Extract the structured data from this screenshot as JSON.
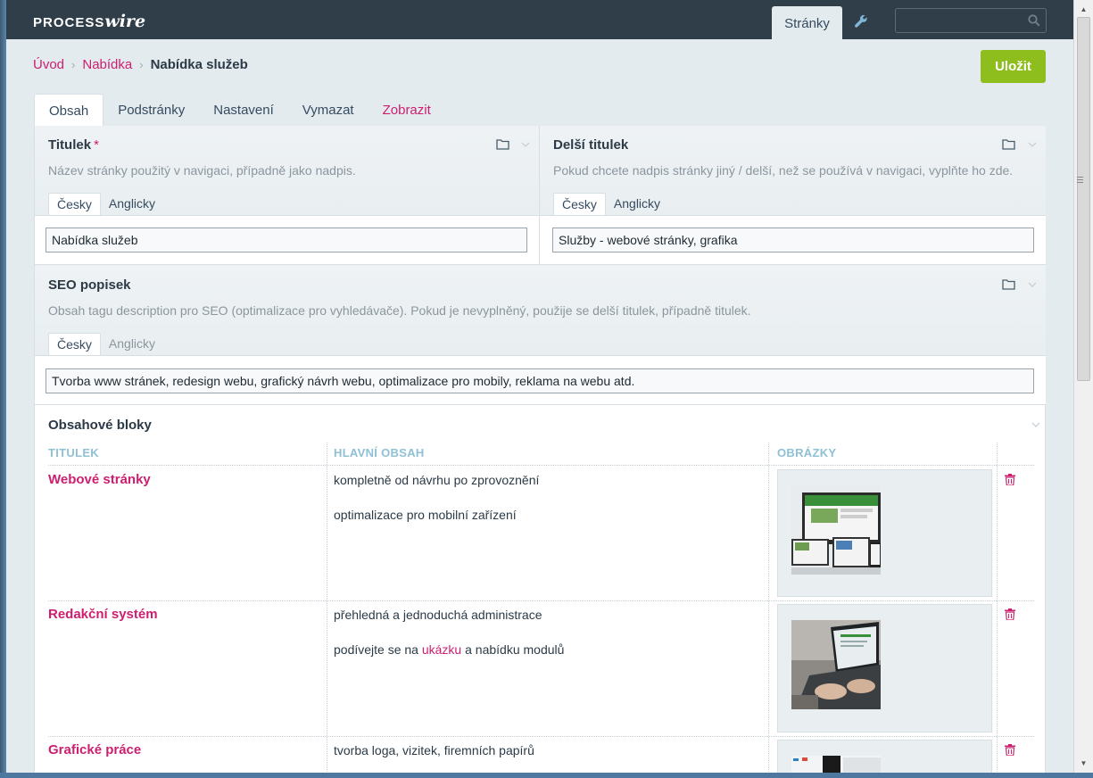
{
  "masthead": {
    "logo_main": "PROCESS",
    "logo_accent": "wire",
    "nav_pages": "Stránky",
    "search_placeholder": ""
  },
  "breadcrumb": {
    "items": [
      "Úvod",
      "Nabídka"
    ],
    "current": "Nabídka služeb"
  },
  "save_label": "Uložit",
  "tabs": [
    "Obsah",
    "Podstránky",
    "Nastavení",
    "Vymazat",
    "Zobrazit"
  ],
  "fields": {
    "title": {
      "label": "Titulek",
      "required_mark": "*",
      "description": "Název stránky použitý v navigaci, případně jako nadpis.",
      "lang_tabs": [
        "Česky",
        "Anglicky"
      ],
      "value": "Nabídka služeb"
    },
    "long_title": {
      "label": "Delší titulek",
      "description": "Pokud chcete nadpis stránky jiný / delší, než se používá v navigaci, vyplňte ho zde.",
      "lang_tabs": [
        "Česky",
        "Anglicky"
      ],
      "value": "Služby - webové stránky, grafika"
    },
    "seo": {
      "label": "SEO popisek",
      "description": "Obsah tagu description pro SEO (optimalizace pro vyhledávače). Pokud je nevyplněný, použije se delší titulek, případně titulek.",
      "lang_tabs": [
        "Česky",
        "Anglicky"
      ],
      "value": "Tvorba www stránek, redesign webu, grafický návrh webu, optimalizace pro mobily, reklama na webu atd."
    }
  },
  "blocks": {
    "title": "Obsahové bloky",
    "columns": [
      "TITULEK",
      "HLAVNÍ OBSAH",
      "OBRÁZKY"
    ],
    "rows": [
      {
        "title": "Webové stránky",
        "line1": "kompletně od návrhu po zprovoznění",
        "line2": "optimalizace pro mobilní zařízení"
      },
      {
        "title": "Redakční systém",
        "line1": "přehledná a jednoduchá administrace",
        "line2_pre": "podívejte se na",
        "line2_link": "ukázku",
        "line2_post": "a nabídku modulů"
      },
      {
        "title": "Grafické práce",
        "line1": "tvorba loga, vizitek, firemních papírů"
      }
    ]
  },
  "colors": {
    "accent": "#cc1f6f",
    "save": "#8dbe1e",
    "masthead": "#2f3e49"
  }
}
